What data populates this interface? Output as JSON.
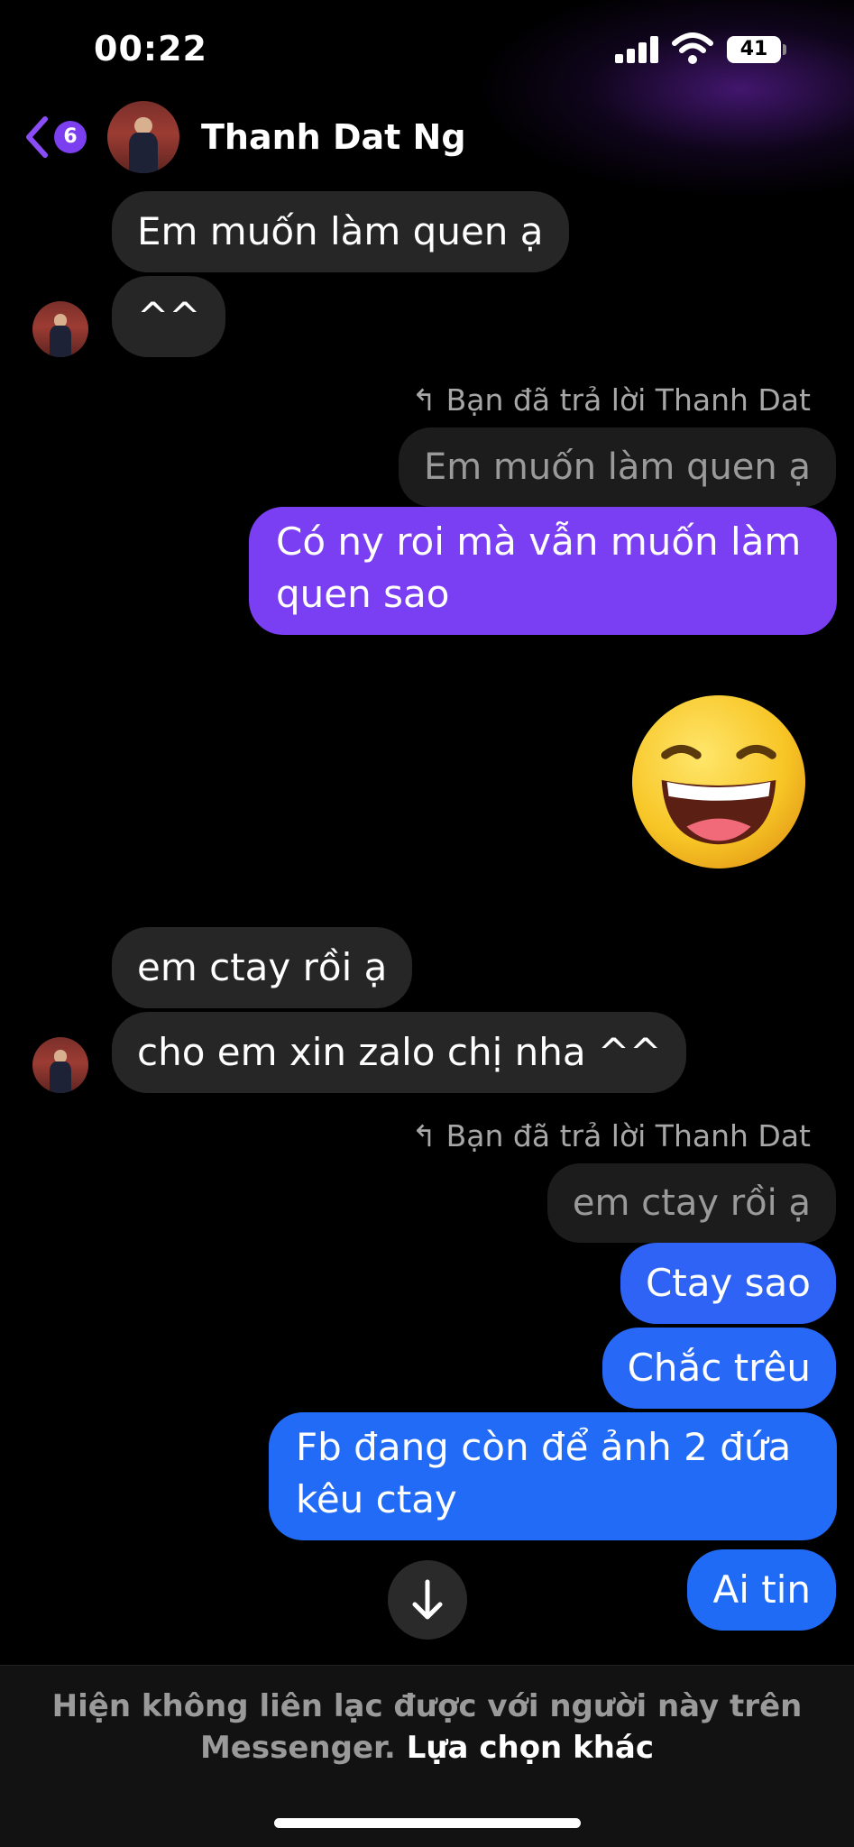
{
  "status_bar": {
    "time": "00:22",
    "battery": "41"
  },
  "header": {
    "back_badge": "6",
    "contact_name": "Thanh Dat Ng"
  },
  "messages": {
    "m1": "Em muốn làm quen ạ",
    "m2": "^^",
    "reply1_label": "Bạn đã trả lời Thanh Dat",
    "reply1_quote": "Em muốn làm quen ạ",
    "m3_line1": "Có ny roi mà vẫn muốn làm",
    "m3_line2": "quen sao",
    "m4": "em ctay rồi ạ",
    "m5": "cho em xin zalo chị nha ^^",
    "reply2_label": "Bạn đã trả lời Thanh Dat",
    "reply2_quote": "em ctay rồi ạ",
    "m6": "Ctay sao",
    "m7": "Chắc trêu",
    "m8_line1": "Fb đang còn để ảnh 2 đứa",
    "m8_line2": "kêu ctay",
    "m9": "Ai tin"
  },
  "footer": {
    "text_line1": "Hiện không liên lạc được với người này trên",
    "text_line2": "Messenger.",
    "link": "Lựa chọn khác"
  },
  "colors": {
    "accent": "#7b3ff0",
    "sent_purple": "#7a3ff2",
    "sent_blue": "#1f6bf6",
    "received_bubble": "#262626"
  },
  "icons": [
    "back-chevron-icon",
    "signal-icon",
    "wifi-icon",
    "battery-icon",
    "reply-arrow-icon",
    "laughing-emoji-icon",
    "arrow-down-icon"
  ]
}
